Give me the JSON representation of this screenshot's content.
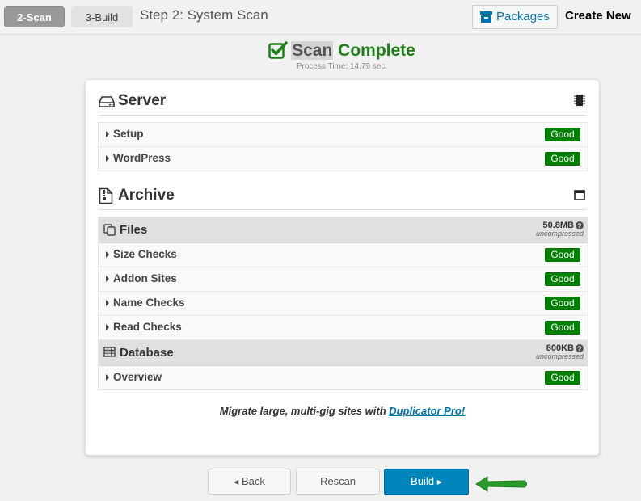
{
  "steps": {
    "active": "2-Scan",
    "next": "3-Build",
    "title": "Step 2: System Scan"
  },
  "header_actions": {
    "packages": "Packages",
    "create_new": "Create New"
  },
  "scan": {
    "word_scan": "Scan",
    "word_complete": "Complete",
    "process_time": "Process Time: 14.79 sec."
  },
  "server": {
    "title": "Server",
    "rows": [
      {
        "label": "Setup",
        "status": "Good"
      },
      {
        "label": "WordPress",
        "status": "Good"
      }
    ]
  },
  "archive": {
    "title": "Archive",
    "files": {
      "title": "Files",
      "size": "50.8MB",
      "size_note": "uncompressed",
      "rows": [
        {
          "label": "Size Checks",
          "status": "Good"
        },
        {
          "label": "Addon Sites",
          "status": "Good"
        },
        {
          "label": "Name Checks",
          "status": "Good"
        },
        {
          "label": "Read Checks",
          "status": "Good"
        }
      ]
    },
    "database": {
      "title": "Database",
      "size": "800KB",
      "size_note": "uncompressed",
      "rows": [
        {
          "label": "Overview",
          "status": "Good"
        }
      ]
    }
  },
  "promo": {
    "text": "Migrate large, multi-gig sites with ",
    "link": "Duplicator Pro!"
  },
  "buttons": {
    "back": "Back",
    "rescan": "Rescan",
    "build": "Build"
  },
  "colors": {
    "good_badge": "#008000",
    "complete_text": "#1f7e17",
    "primary_button": "#0085ba",
    "link": "#0073aa"
  }
}
